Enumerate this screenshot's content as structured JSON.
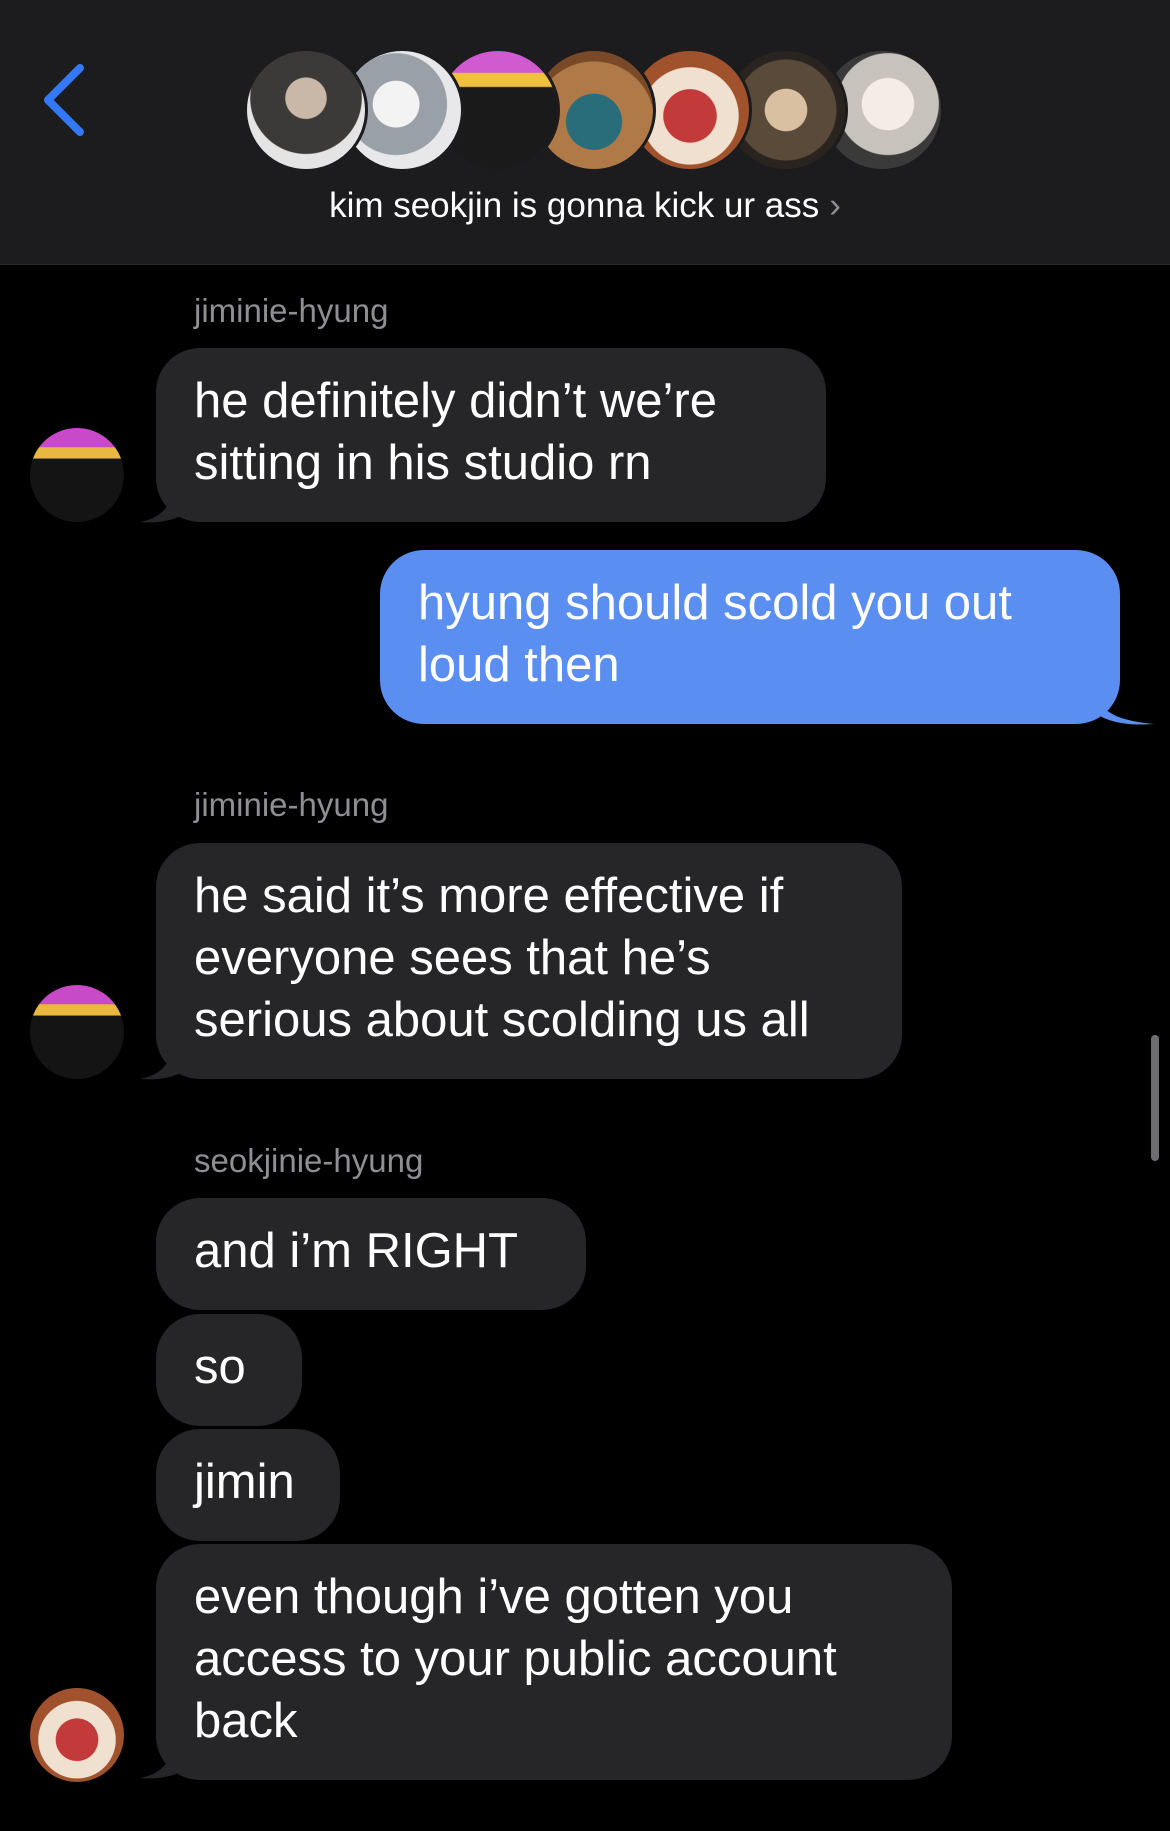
{
  "header": {
    "back_icon": "chevron-left-icon",
    "group_name": "kim seokjin is gonna kick ur ass",
    "chevron": "›",
    "accent": "#3478f6",
    "avatars": [
      "avatar-1",
      "avatar-2",
      "avatar-3",
      "avatar-4",
      "avatar-5",
      "avatar-6",
      "avatar-7"
    ]
  },
  "messages": [
    {
      "sender": "jiminie-hyung"
    },
    {
      "text": "he definitely didn’t we’re sitting in his studio rn"
    },
    {
      "text": "hyung should scold you out loud then"
    },
    {
      "sender": "jiminie-hyung"
    },
    {
      "text": "he said it’s more effective if everyone sees that he’s serious about scolding us all"
    },
    {
      "sender": "seokjinie-hyung"
    },
    {
      "text": "and i’m RIGHT"
    },
    {
      "text": "so"
    },
    {
      "text": "jimin"
    },
    {
      "text": "even though i’ve gotten you access to your public account back"
    }
  ],
  "colors": {
    "incoming_bubble": "#262628",
    "outgoing_bubble": "#5a8ef0",
    "sender_label": "#8e8e93"
  }
}
